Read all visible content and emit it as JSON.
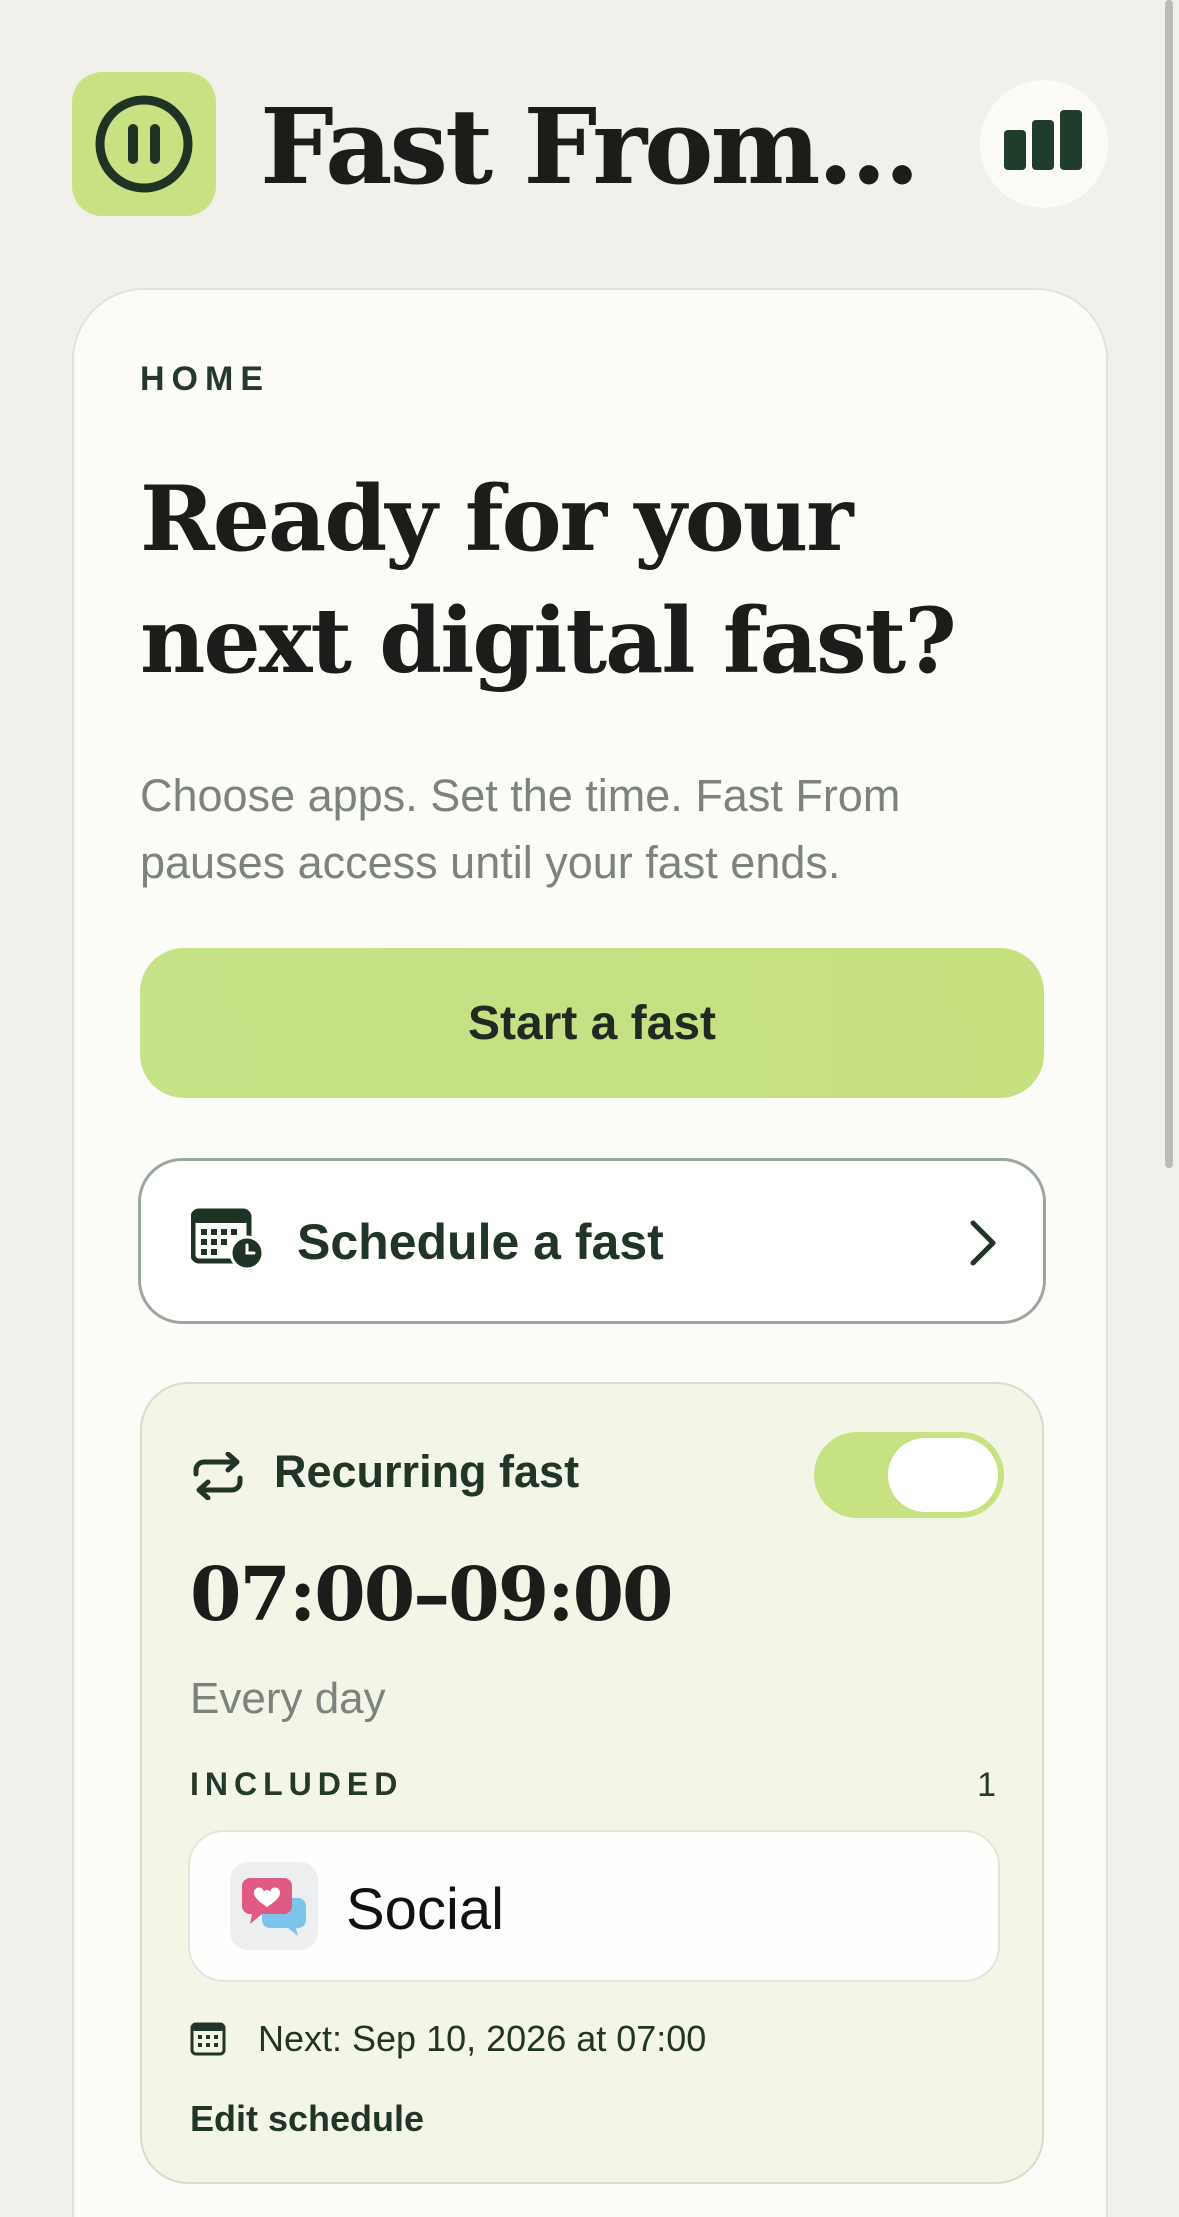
{
  "header": {
    "app_title": "Fast From...",
    "logo_icon": "pause-circle-icon",
    "stats_icon": "bar-chart-icon"
  },
  "home": {
    "section_label": "HOME",
    "headline": "Ready for your next digital fast?",
    "subtitle": "Choose apps. Set the time. Fast From pauses access until your fast ends.",
    "start_label": "Start a fast",
    "schedule_label": "Schedule a fast"
  },
  "recurring": {
    "title": "Recurring fast",
    "enabled": true,
    "time_range": "07:00–09:00",
    "frequency": "Every day",
    "included_label": "INCLUDED",
    "included_count": "1",
    "apps": [
      {
        "name": "Social",
        "icon": "chat-heart-icon"
      }
    ],
    "next": "Next: Sep 10, 2026 at 07:00",
    "edit_label": "Edit schedule"
  },
  "colors": {
    "background": "#f2f0ea",
    "accent_green": "#c6e283",
    "dark_green": "#213526",
    "muted_text": "#7c837c"
  }
}
